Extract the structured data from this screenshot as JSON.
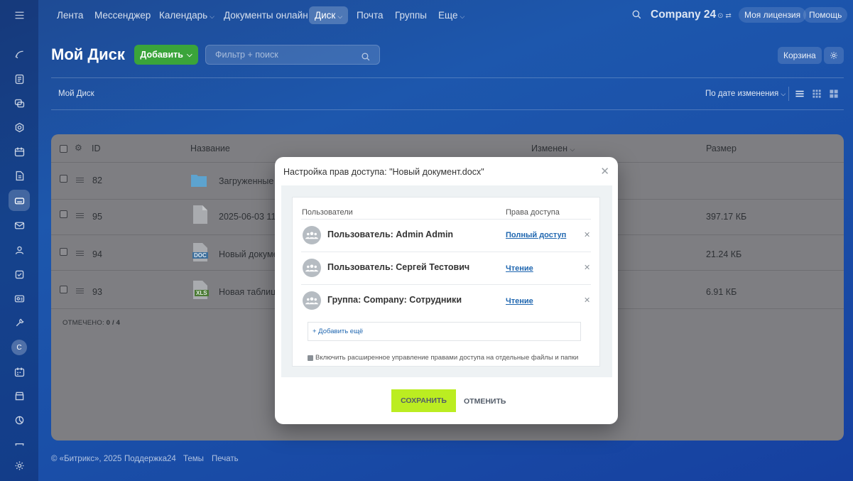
{
  "nav": {
    "items": [
      "Лента",
      "Мессенджер",
      "Календарь",
      "Документы онлайн",
      "Диск",
      "Почта",
      "Группы",
      "Еще"
    ],
    "brand": "Company 24",
    "license": "Моя лицензия",
    "help": "Помощь"
  },
  "sidebar": {
    "letter": "C"
  },
  "page": {
    "title": "Мой Диск",
    "add_label": "Добавить",
    "filter_placeholder": "Фильтр + поиск",
    "trash": "Корзина",
    "breadcrumb": "Мой Диск",
    "sort": "По дате изменения"
  },
  "table": {
    "headers": {
      "id": "ID",
      "name": "Название",
      "modified": "Изменен",
      "size": "Размер"
    },
    "rows": [
      {
        "id": "82",
        "name": "Загруженные ф",
        "size": "",
        "icon": "folder-icon"
      },
      {
        "id": "95",
        "name": "2025-06-03 11-",
        "size": "397.17 КБ",
        "icon": "file-icon"
      },
      {
        "id": "94",
        "name": "Новый докуме",
        "size": "21.24 КБ",
        "icon": "doc-icon",
        "badge": "DOC"
      },
      {
        "id": "93",
        "name": "Новая таблица",
        "size": "6.91 КБ",
        "icon": "xls-icon",
        "badge": "XLS"
      }
    ],
    "marked_label": "ОТМЕЧЕНО:",
    "marked_value": "0 / 4"
  },
  "footer": {
    "copyright": "© «Битрикс», 2025",
    "support": "Поддержка24",
    "themes": "Темы",
    "print": "Печать"
  },
  "modal": {
    "title": "Настройка прав доступа: \"Новый документ.docx\"",
    "col_users": "Пользователи",
    "col_rights": "Права доступа",
    "entries": [
      {
        "name": "Пользователь: Admin Admin",
        "rights": "Полный доступ"
      },
      {
        "name": "Пользователь: Сергей Тестович",
        "rights": "Чтение"
      },
      {
        "name": "Группа: Company: Сотрудники",
        "rights": "Чтение"
      }
    ],
    "add_more": "+ Добавить ещё",
    "extended_label": "Включить расширенное управление правами доступа на отдельные файлы и папки",
    "save": "СОХРАНИТЬ",
    "cancel": "ОТМЕНИТЬ"
  },
  "colors": {
    "accent_green": "#3aa43a",
    "save_green": "#bbed21",
    "link_blue": "#2067b0"
  }
}
